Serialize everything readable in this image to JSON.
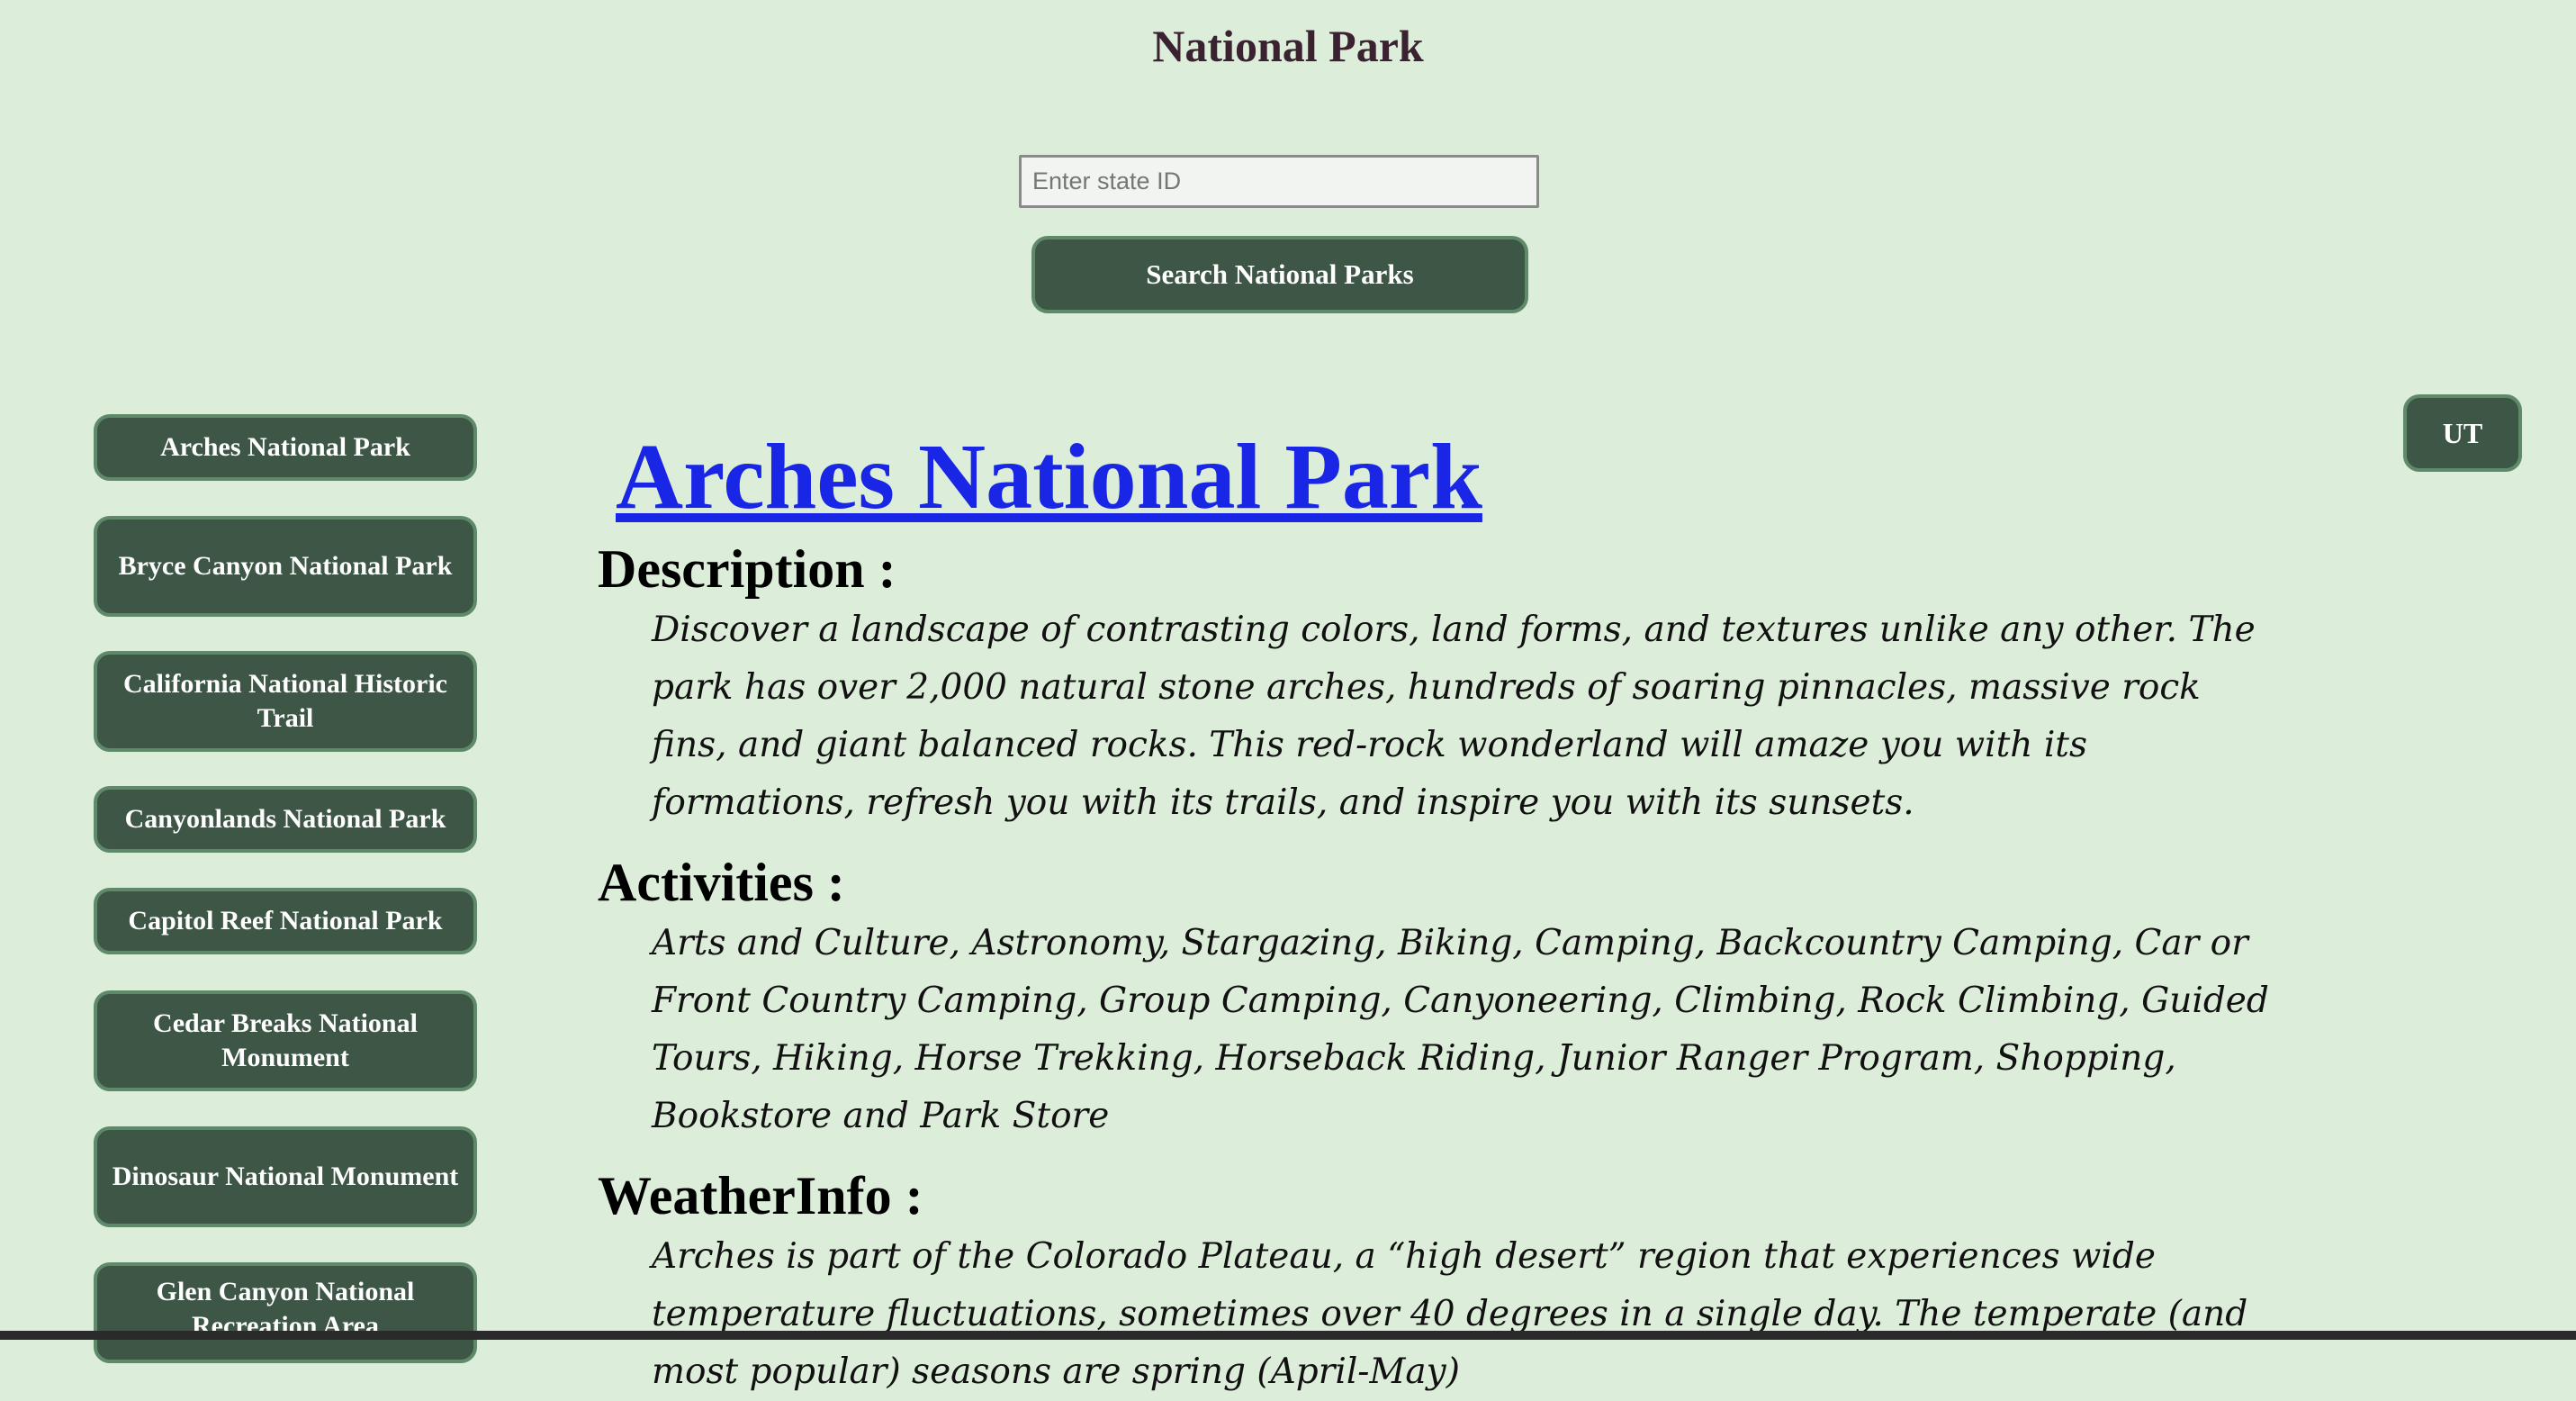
{
  "header": {
    "title": "National Park"
  },
  "search": {
    "placeholder": "Enter state ID",
    "value": "",
    "button_label": "Search National Parks"
  },
  "state_badge": {
    "label": "UT"
  },
  "sidebar": {
    "items": [
      {
        "label": "Arches National Park"
      },
      {
        "label": "Bryce Canyon National Park"
      },
      {
        "label": "California National Historic Trail"
      },
      {
        "label": "Canyonlands National Park"
      },
      {
        "label": "Capitol Reef National Park"
      },
      {
        "label": "Cedar Breaks National Monument"
      },
      {
        "label": "Dinosaur National Monument"
      },
      {
        "label": "Glen Canyon National Recreation Area"
      }
    ]
  },
  "park": {
    "name": "Arches National Park",
    "description_heading": "Description :",
    "description": "Discover a landscape of contrasting colors, land forms, and textures unlike any other. The park has over 2,000 natural stone arches, hundreds of soaring pinnacles, massive rock fins, and giant balanced rocks. This red-rock wonderland will amaze you with its formations, refresh you with its trails, and inspire you with its sunsets.",
    "activities_heading": "Activities :",
    "activities": "Arts and Culture, Astronomy, Stargazing, Biking, Camping, Backcountry Camping, Car or Front Country Camping, Group Camping, Canyoneering, Climbing, Rock Climbing, Guided Tours, Hiking, Horse Trekking, Horseback Riding, Junior Ranger Program, Shopping, Bookstore and Park Store",
    "weather_heading": "WeatherInfo :",
    "weather": "Arches is part of the Colorado Plateau, a “high desert” region that experiences wide temperature fluctuations, sometimes over 40 degrees in a single day. The temperate (and most popular) seasons are spring (April-May)"
  },
  "colors": {
    "background": "#dcedd9",
    "button_bg": "#3d5645",
    "button_border": "#5e8a69",
    "link": "#1a26e6",
    "title": "#3a2230"
  }
}
